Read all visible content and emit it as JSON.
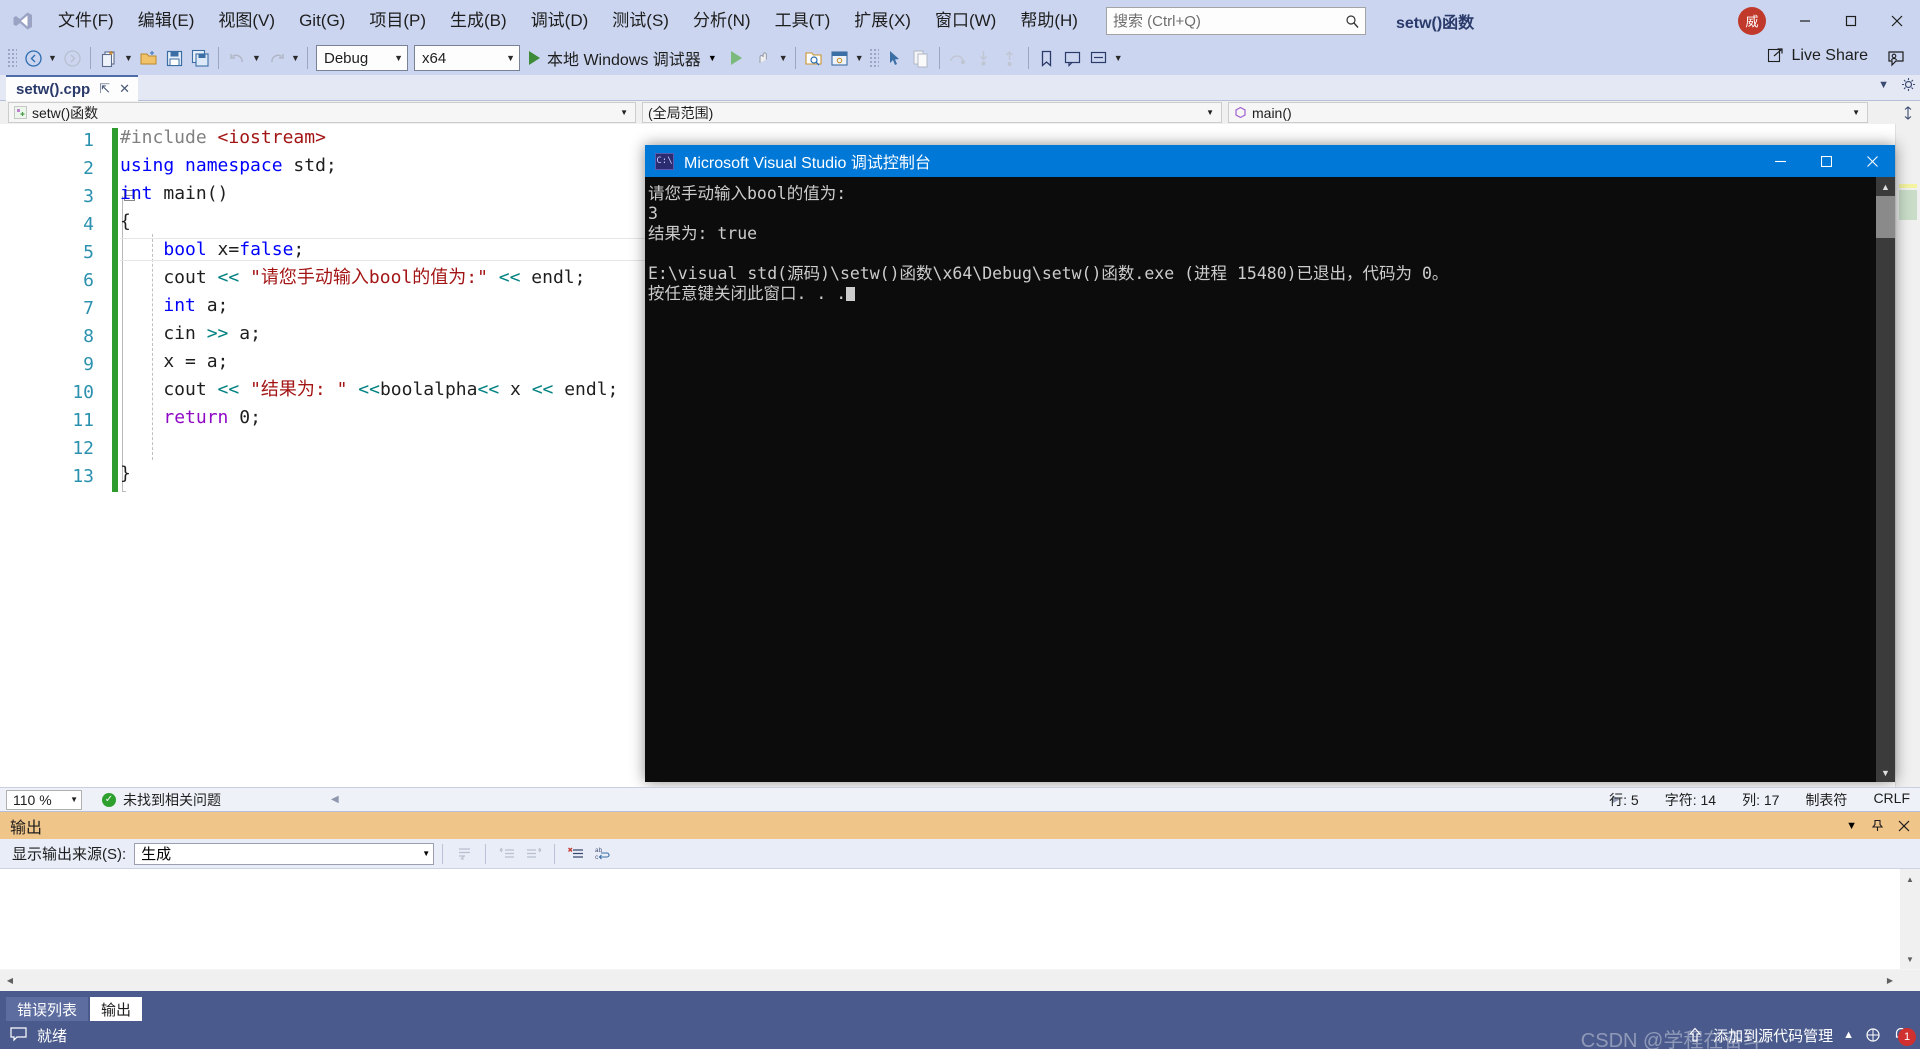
{
  "titlebar": {
    "logo_icon": "visual-studio-logo-icon",
    "menus": [
      {
        "label": "文件(F)"
      },
      {
        "label": "编辑(E)"
      },
      {
        "label": "视图(V)"
      },
      {
        "label": "Git(G)"
      },
      {
        "label": "项目(P)"
      },
      {
        "label": "生成(B)"
      },
      {
        "label": "调试(D)"
      },
      {
        "label": "测试(S)"
      },
      {
        "label": "分析(N)"
      },
      {
        "label": "工具(T)"
      },
      {
        "label": "扩展(X)"
      },
      {
        "label": "窗口(W)"
      },
      {
        "label": "帮助(H)"
      }
    ],
    "search": {
      "placeholder": "搜索 (Ctrl+Q)",
      "value": "",
      "icon": "search-icon"
    },
    "project_title": "setw()函数",
    "avatar_initial": "威",
    "window_controls": {
      "minimize": "—",
      "maximize": "▢",
      "close": "✕"
    }
  },
  "toolbar": {
    "nav_back_icon": "navigate-back-icon",
    "nav_forward_icon": "navigate-forward-icon",
    "new_item_icon": "new-item-icon",
    "open_file_icon": "open-file-icon",
    "save_icon": "save-icon",
    "save_all_icon": "save-all-icon",
    "undo_icon": "undo-icon",
    "redo_icon": "redo-icon",
    "config_value": "Debug",
    "platform_value": "x64",
    "run_label": "本地 Windows 调试器",
    "attach_icon": "attach-to-process-icon",
    "stop_icon": "stop-icon",
    "live_share_label": "Live Share",
    "live_share_icon": "live-share-icon",
    "feedback_icon": "send-feedback-icon"
  },
  "tabstrip": {
    "tab_label": "setw().cpp",
    "pin_icon": "pin-icon",
    "close_icon": "close-icon",
    "chevron_icon": "chevron-down-icon",
    "settings_icon": "gear-icon"
  },
  "navbar": {
    "project_scope": "setw()函数",
    "project_icon": "cpp-project-icon",
    "namespace_scope": "(全局范围)",
    "member_scope": "main()",
    "member_icon": "method-icon",
    "split_icon": "split-view-icon"
  },
  "editor": {
    "lines": [
      {
        "n": "1",
        "text": "#include <iostream>"
      },
      {
        "n": "2",
        "text": "using namespace std;"
      },
      {
        "n": "3",
        "text": "int main()"
      },
      {
        "n": "4",
        "text": "{"
      },
      {
        "n": "5",
        "text": "    bool x=false;"
      },
      {
        "n": "6",
        "text": "    cout << \"请您手动输入bool的值为:\" << endl;"
      },
      {
        "n": "7",
        "text": "    int a;"
      },
      {
        "n": "8",
        "text": "    cin >> a;"
      },
      {
        "n": "9",
        "text": "    x = a;"
      },
      {
        "n": "10",
        "text": "    cout << \"结果为: \" <<boolalpha<< x << endl;"
      },
      {
        "n": "11",
        "text": "    return 0;"
      },
      {
        "n": "12",
        "text": ""
      },
      {
        "n": "13",
        "text": "}"
      }
    ]
  },
  "console": {
    "icon": "console-app-icon",
    "title": "Microsoft Visual Studio 调试控制台",
    "minimize": "—",
    "maximize": "▢",
    "close": "✕",
    "output_lines": [
      "请您手动输入bool的值为:",
      "3",
      "结果为: true",
      "",
      "E:\\visual std(源码)\\setw()函数\\x64\\Debug\\setw()函数.exe (进程 15480)已退出，代码为 0。",
      "按任意键关闭此窗口. . ."
    ]
  },
  "editor_status": {
    "zoom": "110 %",
    "problems_text": "未找到相关问题",
    "ok_icon": "check-circle-icon",
    "collapse_icon": "collapse-left-icon",
    "expand_icon": "expand-right-icon",
    "line_label": "行: 5",
    "char_label": "字符: 14",
    "col_label": "列: 17",
    "tab_label": "制表符",
    "eol_label": "CRLF"
  },
  "output_panel": {
    "title": "输出",
    "chevron_icon": "chevron-down-icon",
    "pin_icon": "pin-icon",
    "close_icon": "close-icon",
    "source_label": "显示输出来源(S):",
    "source_value": "生成",
    "buttons": [
      {
        "icon": "goto-message-icon"
      },
      {
        "icon": "previous-message-icon"
      },
      {
        "icon": "next-message-icon"
      },
      {
        "icon": "clear-all-icon"
      },
      {
        "icon": "toggle-word-wrap-icon"
      }
    ]
  },
  "bottom_tabs": [
    {
      "label": "错误列表",
      "active": false
    },
    {
      "label": "输出",
      "active": true
    }
  ],
  "statusbar": {
    "ready_text": "就绪",
    "ready_icon": "ready-callout-icon",
    "source_control_text": "添加到源代码管理",
    "source_control_icon": "upload-arrow-icon",
    "chevron_icon": "chevron-up-icon",
    "repo_icon": "select-repository-icon",
    "notify_icon": "notification-bell-icon",
    "notify_count": "1",
    "watermark": "CSDN @学程在奋斗·"
  },
  "colors": {
    "chrome": "#cbd5ef",
    "accent_blue": "#0078d7",
    "status_blue": "#4a5a8c",
    "output_header": "#f0c589",
    "change_green": "#2e9b2e",
    "string_red": "#a31515",
    "keyword_blue": "#0000ff",
    "type_teal": "#2b91af",
    "macro_gray": "#808080",
    "operator_teal": "#008080",
    "control_purple": "#8f08c4"
  }
}
